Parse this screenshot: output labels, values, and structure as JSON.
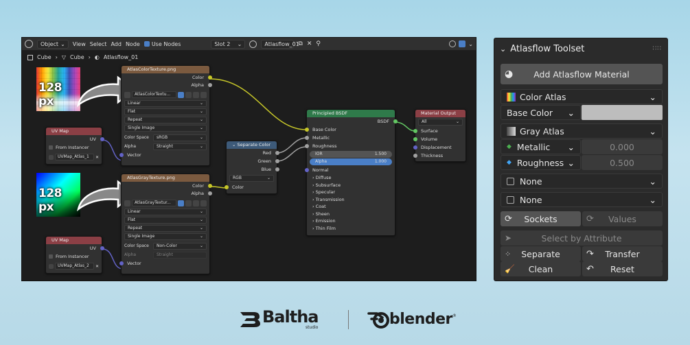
{
  "header": {
    "editor_type": "Object",
    "menus": [
      "View",
      "Select",
      "Add",
      "Node"
    ],
    "use_nodes": "Use Nodes",
    "slot": "Slot 2",
    "material": "Atlasflow_01"
  },
  "breadcrumb": [
    "Cube",
    "Cube",
    "Atlasflow_01"
  ],
  "thumbs": {
    "top_label": "128 px",
    "bottom_label": "128 px"
  },
  "nodes": {
    "color_tex": {
      "title": "AtlasColorTexture.png",
      "out_color": "Color",
      "out_alpha": "Alpha",
      "image": "AtlasColorTextu...",
      "interp": "Linear",
      "proj": "Flat",
      "ext": "Repeat",
      "source": "Single Image",
      "cs_label": "Color Space",
      "cs_value": "sRGB",
      "alpha_label": "Alpha",
      "alpha_value": "Straight",
      "vector": "Vector"
    },
    "gray_tex": {
      "title": "AtlasGrayTexture.png",
      "out_color": "Color",
      "out_alpha": "Alpha",
      "image": "AtlasGrayTextur...",
      "interp": "Linear",
      "proj": "Flat",
      "ext": "Repeat",
      "source": "Single Image",
      "cs_label": "Color Space",
      "cs_value": "Non-Color",
      "alpha_label": "Alpha",
      "alpha_value": "Straight",
      "vector": "Vector"
    },
    "uv1": {
      "title": "UV Map",
      "out": "UV",
      "instancer": "From Instancer",
      "map": "UVMap_Atlas_1"
    },
    "uv2": {
      "title": "UV Map",
      "out": "UV",
      "instancer": "From Instancer",
      "map": "UVMap_Atlas_2"
    },
    "separate": {
      "title": "Separate Color",
      "red": "Red",
      "green": "Green",
      "blue": "Blue",
      "mode": "RGB",
      "in": "Color"
    },
    "bsdf": {
      "title": "Principled BSDF",
      "out": "BSDF",
      "base_color": "Base Color",
      "metallic": "Metallic",
      "roughness": "Roughness",
      "ior_label": "IOR",
      "ior_value": "1.500",
      "alpha_label": "Alpha",
      "alpha_value": "1.000",
      "normal": "Normal",
      "panels": [
        "Diffuse",
        "Subsurface",
        "Specular",
        "Transmission",
        "Coat",
        "Sheen",
        "Emission",
        "Thin Film"
      ]
    },
    "output": {
      "title": "Material Output",
      "target": "All",
      "surface": "Surface",
      "volume": "Volume",
      "displacement": "Displacement",
      "thickness": "Thickness"
    }
  },
  "panel": {
    "title": "Atlasflow Toolset",
    "add_material": "Add Atlasflow Material",
    "color_atlas": "Color Atlas",
    "base_color_label": "Base Color",
    "gray_atlas": "Gray Atlas",
    "metallic_label": "Metallic",
    "metallic_value": "0.000",
    "roughness_label": "Roughness",
    "roughness_value": "0.500",
    "slot3": "None",
    "slot4": "None",
    "sockets": "Sockets",
    "values": "Values",
    "select_by_attr": "Select by Attribute",
    "separate": "Separate",
    "transfer": "Transfer",
    "clean": "Clean",
    "reset": "Reset"
  },
  "footer": {
    "baltha": "Baltha",
    "baltha_sub": "studio",
    "blender": "blender"
  },
  "colors": {
    "link_yellow": "#c7c729",
    "link_purple": "#6363c7",
    "accent_blue": "#4a7fc7",
    "texture_header": "#7b5a3f",
    "shader_header": "#2f7a4a",
    "uv_header": "#8b3f45"
  }
}
